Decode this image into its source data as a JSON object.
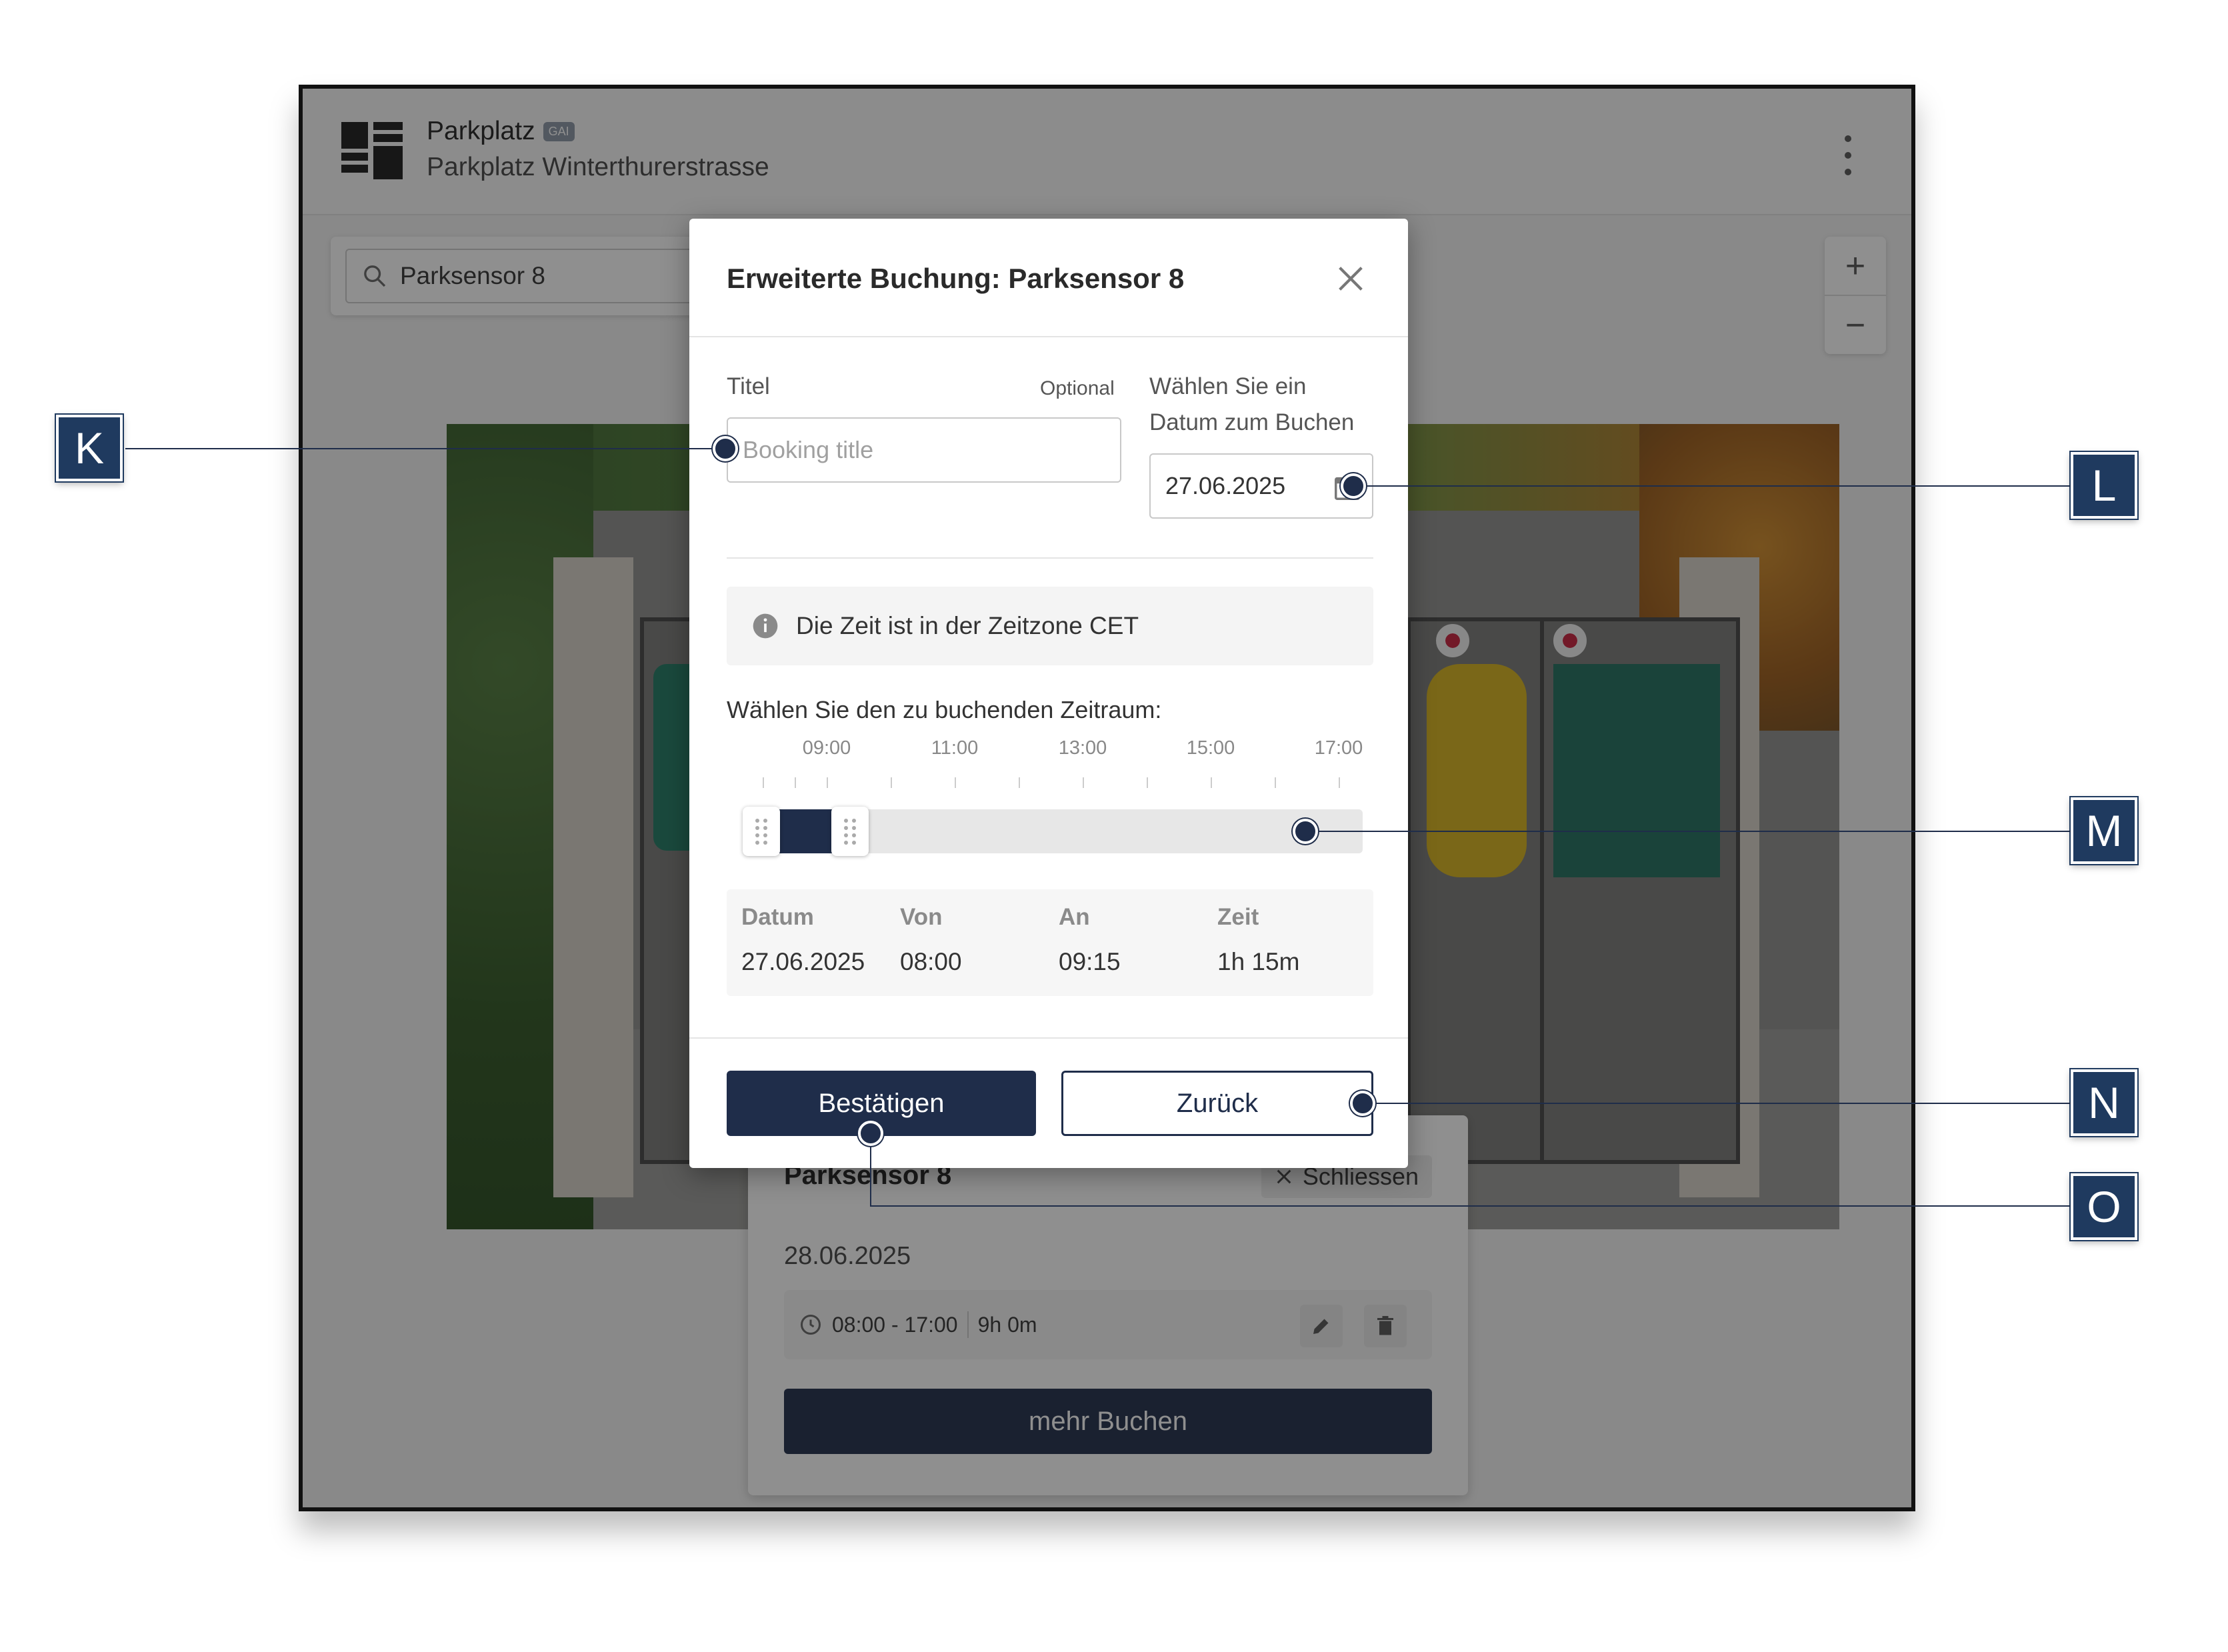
{
  "app": {
    "title": "Parkplatz",
    "badge": "GAI",
    "subtitle": "Parkplatz Winterthurerstrasse"
  },
  "search": {
    "value": "Parksensor 8"
  },
  "zoom": {
    "in": "+",
    "out": "−"
  },
  "panel": {
    "title": "Parksensor 8",
    "close_label": "Schliessen",
    "date": "28.06.2025",
    "slot_time": "08:00 - 17:00",
    "slot_duration": "9h 0m",
    "more_button": "mehr Buchen"
  },
  "modal": {
    "title": "Erweiterte Buchung: Parksensor 8",
    "title_field": {
      "label": "Titel",
      "optional": "Optional",
      "placeholder": "Booking title",
      "value": ""
    },
    "date_field": {
      "label_line1": "Wählen Sie ein",
      "label_line2": "Datum zum Buchen",
      "value": "27.06.2025"
    },
    "timezone_info": "Die Zeit ist in der Zeitzone CET",
    "range_label": "Wählen Sie den zu buchenden Zeitraum:",
    "tick_labels": [
      "09:00",
      "11:00",
      "13:00",
      "15:00",
      "17:00"
    ],
    "slider": {
      "from": "08:00",
      "to": "09:15",
      "selected_fraction_start": 0.0,
      "selected_fraction_end": 0.083
    },
    "summary": {
      "headers": [
        "Datum",
        "Von",
        "An",
        "Zeit"
      ],
      "values": [
        "27.06.2025",
        "08:00",
        "09:15",
        "1h 15m"
      ]
    },
    "confirm_button": "Bestätigen",
    "back_button": "Zurück"
  },
  "callouts": [
    "K",
    "L",
    "M",
    "N",
    "O"
  ],
  "colors": {
    "primary": "#1f2d4a",
    "callout": "#1f3a5f",
    "overlay": "rgba(20,20,20,0.48)"
  }
}
